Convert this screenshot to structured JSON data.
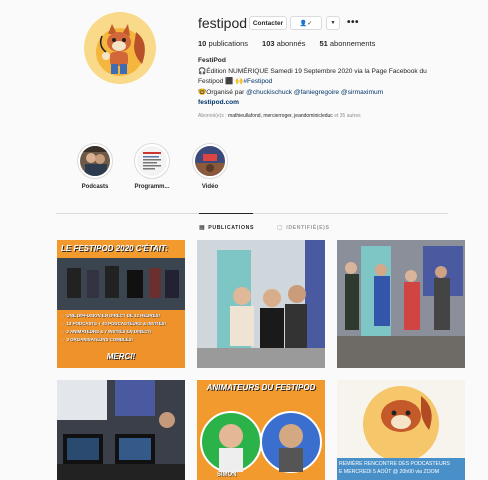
{
  "profile": {
    "username": "festipod",
    "contact_label": "Contacter",
    "follow_icon": "person-check-icon",
    "arrow_icon": "chevron-down-icon",
    "more_icon": "more-icon",
    "stats": {
      "publications_count": "10",
      "publications_label": "publications",
      "followers_count": "103",
      "followers_label": "abonnés",
      "following_count": "51",
      "following_label": "abonnements"
    },
    "bio": {
      "name": "FestiPod",
      "line1": "🎧Édition NUMÉRIQUE Samedi 19 Septembre 2020 via la Page Facebook du",
      "line2_text": "Festipod ⬛ 🙌",
      "line2_tag": "#Festipod",
      "line3_prefix": "🤓Organisé par ",
      "line3_mentions": "@chuckischuck @faniegregoire @sirmaximum",
      "link": "festipod.com"
    },
    "followed_by_prefix": "Abonné(e)s : ",
    "followed_by_names": "mathieullafond, mercierroger, jeandominicleduc",
    "followed_by_suffix": " et 35 autres"
  },
  "highlights": [
    {
      "label": "Podcasts"
    },
    {
      "label": "Programm..."
    },
    {
      "label": "Vidéo"
    }
  ],
  "tabs": {
    "publications": "PUBLICATIONS",
    "tagged": "IDENTIFIÉ(E)S"
  },
  "posts": {
    "post1": {
      "title": "LE FESTIPOD 2020 C'ÉTAIT:",
      "lines": [
        "→ UNE DIFFUSION EN DIRECT DE 12 HEURES!",
        "→ 13 PODCASTS + 40 PODCASTEURS & INVITÉS!",
        "→ 2 ANIMATEURS & 7 INVITÉS EN DIRECT!",
        "→ 3 ORGANISATEURS COMBLÉS!"
      ],
      "footer": "MERCI!"
    },
    "post5": {
      "title": "ANIMATEURS DU FESTIPOD",
      "name": "SIMON"
    },
    "post6": {
      "line1": "REMIÈRE RENCONTRE DES PODCASTEURS",
      "line2": "E MERCREDI 5 AOÛT @ 20h00 via ZOOM"
    }
  },
  "colors": {
    "accent": "#003569",
    "orange": "#f08a24",
    "border": "#dbdbdb"
  }
}
